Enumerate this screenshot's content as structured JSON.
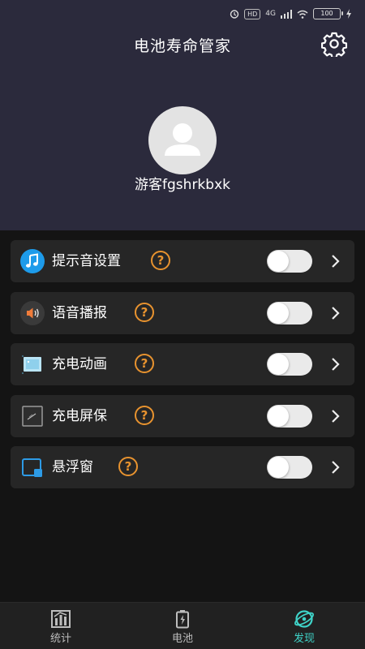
{
  "status_bar": {
    "network": "4G",
    "battery_level": "100"
  },
  "header": {
    "app_title": "电池寿命管家",
    "username": "游客fgshrkbxk"
  },
  "features": [
    {
      "label": "提示音设置",
      "icon": "music-note-icon",
      "enabled": false
    },
    {
      "label": "语音播报",
      "icon": "speaker-icon",
      "enabled": false
    },
    {
      "label": "充电动画",
      "icon": "image-icon",
      "enabled": false
    },
    {
      "label": "充电屏保",
      "icon": "screensaver-icon",
      "enabled": false
    },
    {
      "label": "悬浮窗",
      "icon": "floating-window-icon",
      "enabled": false
    }
  ],
  "help_symbol": "?",
  "tabs": [
    {
      "label": "统计",
      "icon": "stats-chart-icon",
      "active": false
    },
    {
      "label": "电池",
      "icon": "battery-icon",
      "active": false
    },
    {
      "label": "发现",
      "icon": "discover-icon",
      "active": true
    }
  ],
  "colors": {
    "header_bg": "#2b2a3c",
    "accent": "#3fd2c7",
    "help_orange": "#e8932f",
    "card_bg": "#262626"
  }
}
